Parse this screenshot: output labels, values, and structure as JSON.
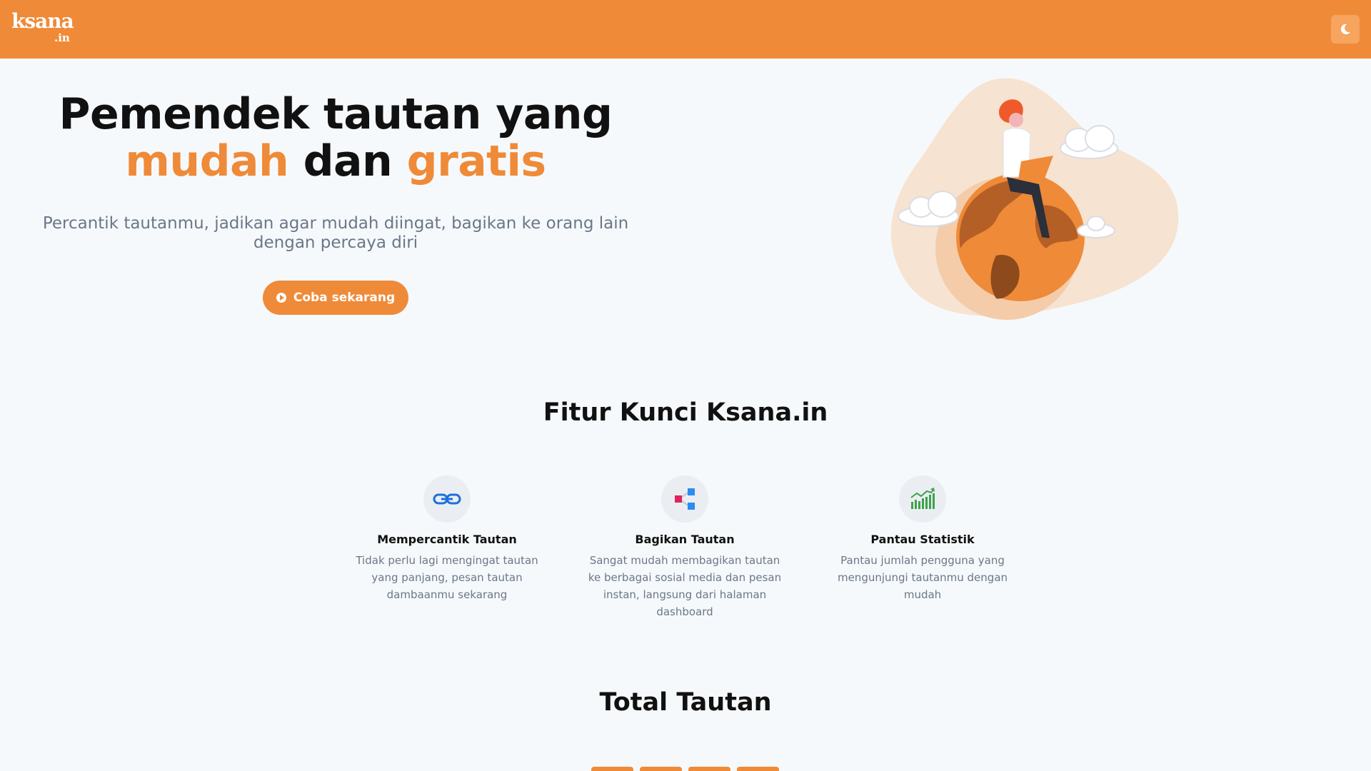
{
  "nav": {
    "logo_main": "ksana",
    "logo_sub": ".in",
    "theme_toggle_icon": "moon-icon"
  },
  "hero": {
    "title_line1": "Pemendek tautan yang",
    "title_word1": "mudah",
    "title_word2": "dan",
    "title_word3": "gratis",
    "subtitle": "Percantik tautanmu, jadikan agar mudah diingat, bagikan ke orang lain dengan percaya diri",
    "cta_label": "Coba sekarang",
    "cta_icon": "play-circle-icon"
  },
  "features": {
    "title": "Fitur Kunci Ksana.in",
    "items": [
      {
        "icon": "link-icon",
        "title": "Mempercantik Tautan",
        "desc": "Tidak perlu lagi mengingat tautan yang panjang, pesan tautan dambaanmu sekarang"
      },
      {
        "icon": "share-icon",
        "title": "Bagikan Tautan",
        "desc": "Sangat mudah membagikan tautan ke berbagai sosial media dan pesan instan, langsung dari halaman dashboard"
      },
      {
        "icon": "chart-icon",
        "title": "Pantau Statistik",
        "desc": "Pantau jumlah pengguna yang mengunjungi tautanmu dengan mudah"
      }
    ]
  },
  "totals": {
    "title": "Total Tautan"
  },
  "colors": {
    "accent": "#ef8a38",
    "muted_text": "#6b7788",
    "background": "#f6f9fb"
  }
}
